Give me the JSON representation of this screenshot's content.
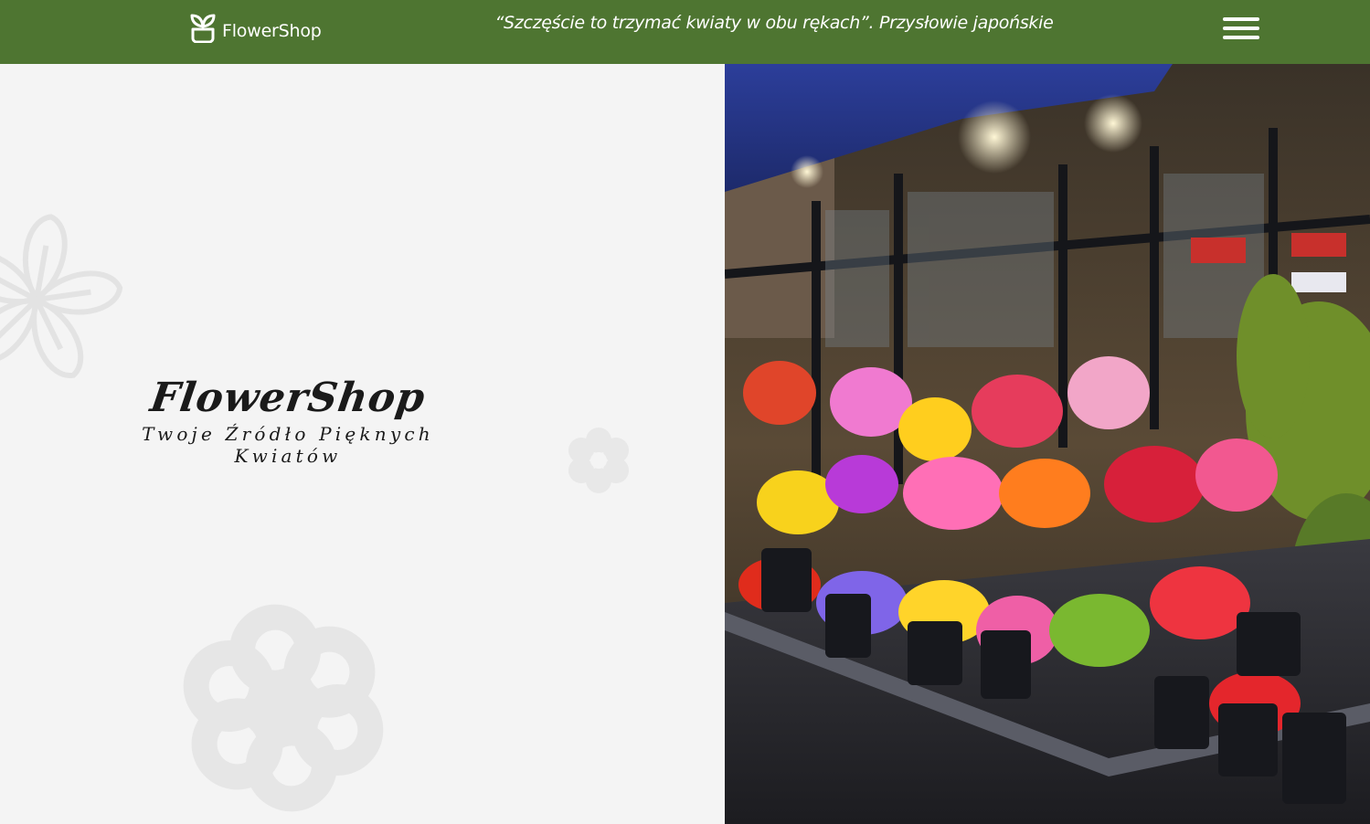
{
  "header": {
    "logo_text": "FlowerShop",
    "logo_icon": "sprout-icon",
    "quote": "“Szczęście to trzymać kwiaty w obu rękach”. Przysłowie japońskie",
    "menu_icon": "hamburger-menu-icon"
  },
  "hero": {
    "title": "FlowerShop",
    "subtitle": "Twoje Źródło Pięknych Kwiatów"
  },
  "colors": {
    "header_bg": "#4e7531",
    "page_bg": "#f4f4f4",
    "decor_flower": "#e6e6e6",
    "text_dark": "#1a1a1a"
  }
}
